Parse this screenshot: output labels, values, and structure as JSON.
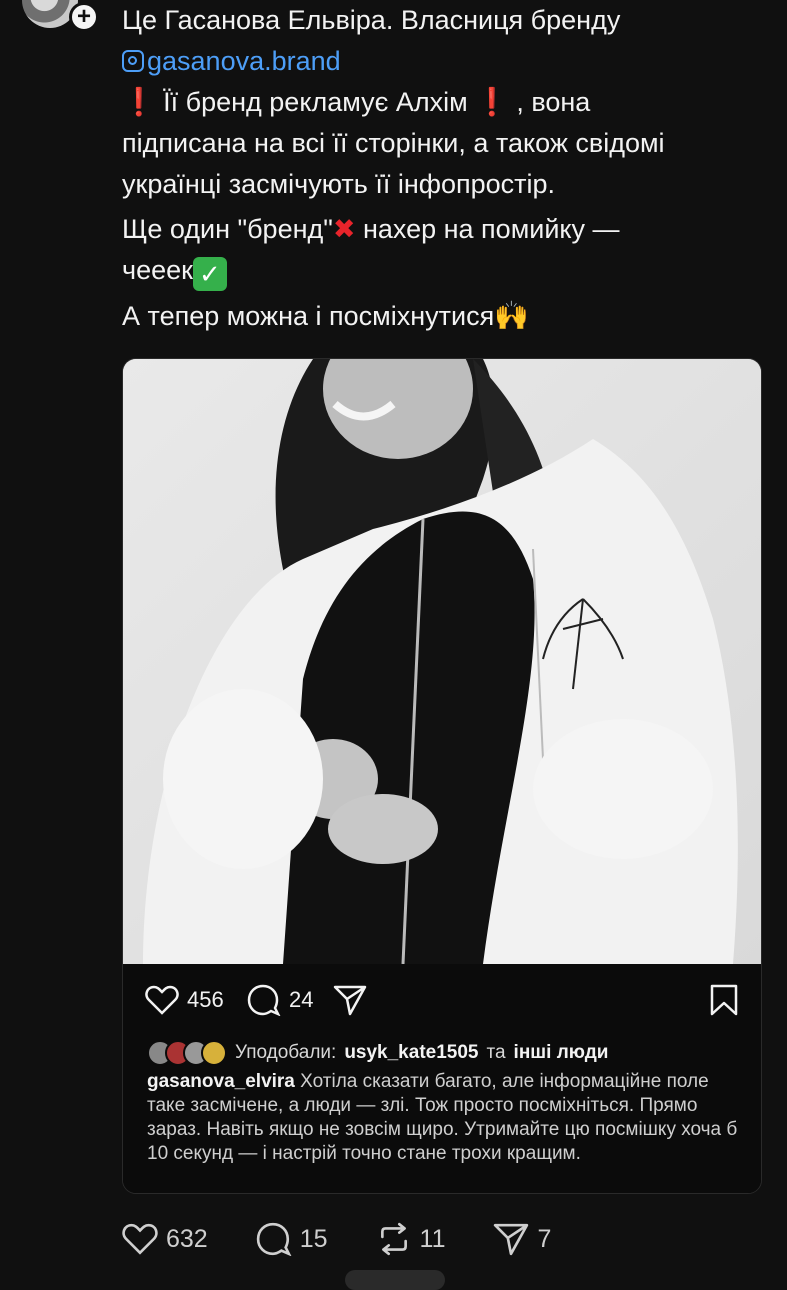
{
  "post": {
    "line1": "Це Гасанова Ельвіра. Власниця бренду",
    "mention": "gasanova.brand",
    "line3": " Її бренд рекламує Алхім",
    "line3b": " , вона",
    "line4": "підписана на всі її сторінки, а також свідомі",
    "line5": "українці засмічують її інфопростір.",
    "line6a": "Ще один \"бренд\"",
    "line6b": " нахер на помийку —",
    "line7": "чееек",
    "line8": "А тепер можна і посміхнутися",
    "emoji_exclaim": "❗",
    "emoji_x": "✖",
    "emoji_check": "✓",
    "emoji_hands": "🙌"
  },
  "embed": {
    "likes": "456",
    "comments": "24",
    "liked_by_prefix": "Уподобали:",
    "liked_by_user": "usyk_kate1505",
    "liked_by_and": "та",
    "liked_by_others": "інші люди",
    "caption_user": "gasanova_elvira",
    "caption_text": "Хотіла сказати багато, але інформаційне поле таке засмічене, а люди — злі. Тож просто посміхніться. Прямо зараз. Навіть якщо не зовсім щиро. Утримайте цю посмішку хоча б 10 секунд — і настрій точно стане трохи кращим."
  },
  "footer": {
    "likes": "632",
    "replies": "15",
    "reposts": "11",
    "shares": "7"
  },
  "colors": {
    "background": "#101010",
    "link": "#4d9ef7",
    "red_emoji": "#e8242b",
    "green_check": "#35b04b"
  }
}
